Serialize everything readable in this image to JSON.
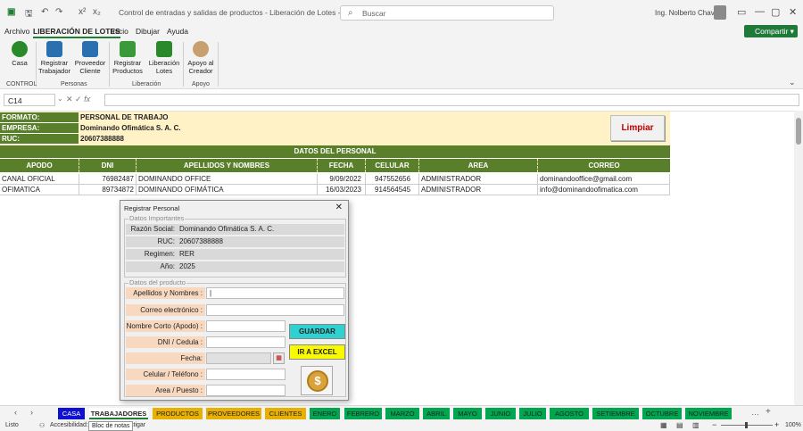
{
  "window": {
    "doc_title": "Control de entradas y salidas de productos - Liberación de Lotes - copia  -  E...",
    "search_placeholder": "Buscar",
    "user_name": "Ing. Nolberto Chavez",
    "share_label": "Compartir"
  },
  "menu": [
    "Archivo",
    "LIBERACIÓN DE LOTES",
    "Inicio",
    "Dibujar",
    "Ayuda"
  ],
  "ribbon": {
    "buttons": [
      {
        "label1": "Casa",
        "label2": "",
        "icon": "house-icon",
        "color": "#2a8a2a"
      },
      {
        "label1": "Registrar",
        "label2": "Trabajador",
        "icon": "worker-icon",
        "color": "#2a6fb0"
      },
      {
        "label1": "Proveedor",
        "label2": "Cliente",
        "icon": "supplier-icon",
        "color": "#2a6fb0"
      },
      {
        "label1": "Registrar",
        "label2": "Productos",
        "icon": "product-icon",
        "color": "#3a9a3a"
      },
      {
        "label1": "Liberación",
        "label2": "Lotes",
        "icon": "lots-icon",
        "color": "#2a8a2a"
      },
      {
        "label1": "Apoyo al",
        "label2": "Creador",
        "icon": "support-icon",
        "color": "#c8a070"
      }
    ],
    "groups": [
      "CONTROL",
      "Personas",
      "Liberación",
      "Apoyo"
    ]
  },
  "formula_bar": {
    "name_box": "C14",
    "fx": "fx",
    "value": ""
  },
  "sheet": {
    "info": [
      {
        "label": "FORMATO:",
        "value": "PERSONAL DE TRABAJO"
      },
      {
        "label": "EMPRESA:",
        "value": "Dominando Ofimática S. A. C."
      },
      {
        "label": "RUC:",
        "value": "20607388888"
      }
    ],
    "limpiar_label": "Limpiar",
    "section_title": "DATOS DEL PERSONAL",
    "columns": [
      "APODO",
      "DNI",
      "APELLIDOS Y NOMBRES",
      "FECHA",
      "CELULAR",
      "AREA",
      "CORREO"
    ],
    "rows": [
      [
        "CANAL OFICIAL",
        "76982487",
        "DOMINANDO OFFICE",
        "9/09/2022",
        "947552656",
        "ADMINISTRADOR",
        "dominandooffice@gmail.com"
      ],
      [
        "OFIMATICA",
        "89734872",
        "DOMINANDO OFIMÁTICA",
        "16/03/2023",
        "914564545",
        "ADMINISTRADOR",
        "info@dominandoofimatica.com"
      ]
    ]
  },
  "dialog": {
    "title": "Registrar Personal",
    "frame1_label": "Datos Importantes",
    "info": [
      {
        "label": "Razón Social:",
        "value": "Dominando Ofimática S. A. C."
      },
      {
        "label": "RUC:",
        "value": "20607388888"
      },
      {
        "label": "Regimen:",
        "value": "RER"
      },
      {
        "label": "Año:",
        "value": "2025"
      }
    ],
    "frame2_label": "Datos del producto",
    "fields": [
      {
        "label": "Apellidos y Nombres :",
        "value": "|"
      },
      {
        "label": "Correo electrónico :",
        "value": ""
      },
      {
        "label": "Nombre Corto (Apodo) :",
        "value": ""
      },
      {
        "label": "DNI / Cedula :",
        "value": ""
      },
      {
        "label": "Fecha:",
        "value": ""
      },
      {
        "label": "Celular / Teléfono :",
        "value": ""
      },
      {
        "label": "Area / Puesto :",
        "value": ""
      }
    ],
    "guardar_label": "GUARDAR",
    "irexcel_label": "IR A EXCEL"
  },
  "tabs": [
    {
      "label": "CASA",
      "color": "#1010d0"
    },
    {
      "label": "TRABAJADORES",
      "color": "#ffffff",
      "active": true
    },
    {
      "label": "PRODUCTOS",
      "color": "#e8b000"
    },
    {
      "label": "PROVEEDORES",
      "color": "#e8b000"
    },
    {
      "label": "CLIENTES",
      "color": "#e8b000"
    },
    {
      "label": "ENERO",
      "color": "#00a650"
    },
    {
      "label": "FEBRERO",
      "color": "#00a650"
    },
    {
      "label": "MARZO",
      "color": "#00a650"
    },
    {
      "label": "ABRIL",
      "color": "#00a650"
    },
    {
      "label": "MAYO",
      "color": "#00a650"
    },
    {
      "label": "JUNIO",
      "color": "#00a650"
    },
    {
      "label": "JULIO",
      "color": "#00a650"
    },
    {
      "label": "AGOSTO",
      "color": "#00a650"
    },
    {
      "label": "SETIEMBRE",
      "color": "#00a650"
    },
    {
      "label": "OCTUBRE",
      "color": "#00a650"
    },
    {
      "label": "NOVIEMBRE",
      "color": "#00a650"
    }
  ],
  "status": {
    "ready": "Listo",
    "accessibility": "Accesibilidad:",
    "accessibility_tail": "stigar",
    "tooltip": "Bloc de notas",
    "zoom": "100%"
  }
}
